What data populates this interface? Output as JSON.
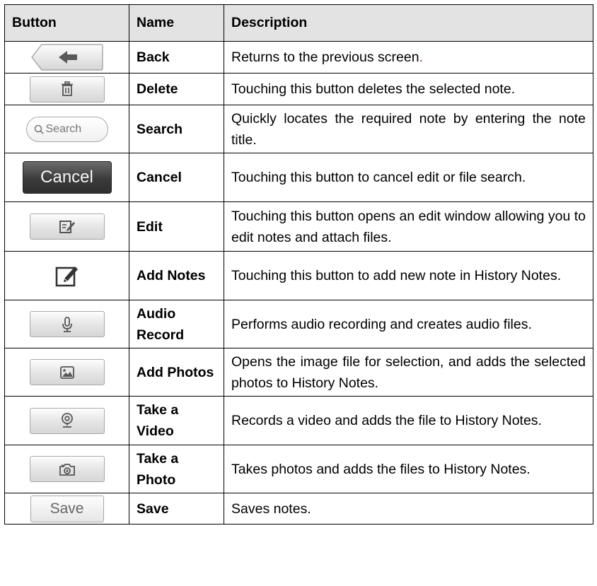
{
  "headers": {
    "button": "Button",
    "name": "Name",
    "description": "Description"
  },
  "rows": [
    {
      "icon": "back-arrow-icon",
      "name": "Back",
      "desc": "Returns to the previous screen",
      "desc_suffix": "."
    },
    {
      "icon": "trash-icon",
      "name": "Delete",
      "desc": "Touching this button deletes the selected note."
    },
    {
      "icon": "search-icon",
      "button_text": "Search",
      "name": "Search",
      "desc": "Quickly locates the required note by entering the note title."
    },
    {
      "button_text": "Cancel",
      "name": "Cancel",
      "desc": "Touching this button to cancel edit or file search."
    },
    {
      "icon": "edit-icon",
      "name": "Edit",
      "desc": "Touching this button opens an edit window allowing you to edit notes and attach files."
    },
    {
      "icon": "add-note-icon",
      "name": "Add Notes",
      "desc": "Touching this button to add new note in History Notes."
    },
    {
      "icon": "microphone-icon",
      "name": "Audio Record",
      "desc": "Performs audio recording and creates audio files."
    },
    {
      "icon": "photo-icon",
      "name": "Add Photos",
      "desc": "Opens the image file for selection, and adds the selected photos to History Notes."
    },
    {
      "icon": "webcam-icon",
      "name": "Take a Video",
      "desc": "Records a video and adds the file to History Notes."
    },
    {
      "icon": "camera-icon",
      "name": "Take a Photo",
      "desc": "Takes photos and adds the files to History Notes."
    },
    {
      "button_text": "Save",
      "name": "Save",
      "desc": "Saves notes."
    }
  ],
  "colors": {
    "header_bg": "#e3e3e3",
    "border": "#000000",
    "accent_red": "#dd2222",
    "cancel_bg": "#3b3b3b"
  }
}
